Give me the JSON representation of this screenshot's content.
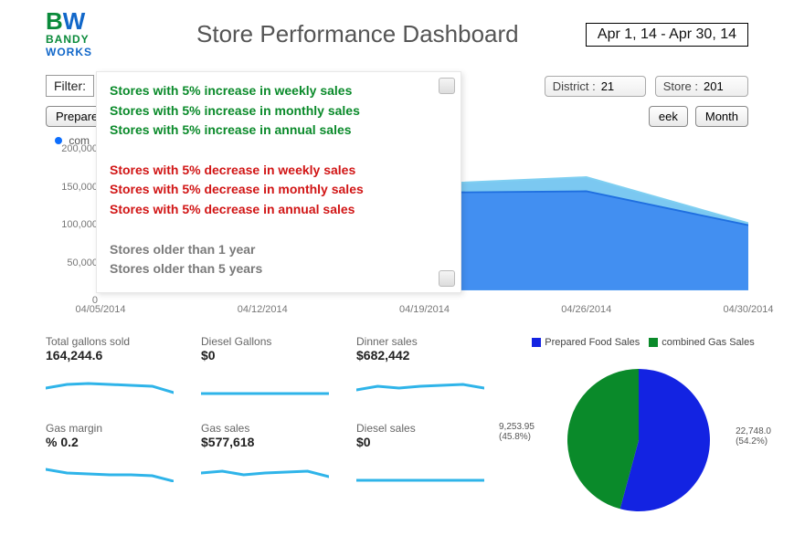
{
  "header": {
    "logo_top": "BW",
    "logo_line1": "BANDY",
    "logo_line2": "WORKS",
    "title": "Store Performance Dashboard",
    "date_range": "Apr 1, 14 - Apr 30, 14"
  },
  "controls": {
    "filter_label": "Filter:",
    "district_label": "District :",
    "district_value": "21",
    "store_label": "Store :",
    "store_value": "201"
  },
  "time_buttons": {
    "prepare_label": "Prepare",
    "week_label": "eek",
    "month_label": "Month"
  },
  "legend": {
    "combined": "combined"
  },
  "filter_dropdown": {
    "items": [
      {
        "text": "Stores with 5% increase in weekly sales",
        "cls": "fd-green"
      },
      {
        "text": "Stores with 5% increase in monthly sales",
        "cls": "fd-green"
      },
      {
        "text": "Stores with 5% increase in annual sales",
        "cls": "fd-green"
      },
      {
        "text": "",
        "cls": ""
      },
      {
        "text": "Stores with 5% decrease in weekly sales",
        "cls": "fd-red"
      },
      {
        "text": "Stores with 5% decrease in monthly sales",
        "cls": "fd-red"
      },
      {
        "text": "Stores with 5% decrease in annual sales",
        "cls": "fd-red"
      },
      {
        "text": "",
        "cls": ""
      },
      {
        "text": "Stores older than 1 year",
        "cls": "fd-gray"
      },
      {
        "text": "Stores older than 5 years",
        "cls": "fd-gray"
      }
    ]
  },
  "chart_data": {
    "type": "area",
    "xlabel": "",
    "ylabel": "",
    "ylim": [
      0,
      200000
    ],
    "y_ticks": [
      "200,000",
      "150,000",
      "100,000",
      "50,000",
      "0"
    ],
    "x_ticks": [
      "04/05/2014",
      "04/12/2014",
      "04/19/2014",
      "04/26/2014",
      "04/30/2014"
    ],
    "series": [
      {
        "name": "combined Gas Sales",
        "color": "#7fcff1",
        "fill": "#6dc2ef",
        "values": [
          90000,
          92000,
          150000,
          160000,
          95000
        ]
      },
      {
        "name": "Prepared Food Sales",
        "color": "#1f6fe0",
        "fill": "#3f8cf0",
        "values": [
          88000,
          90000,
          138000,
          140000,
          92000
        ]
      }
    ]
  },
  "metrics_top": [
    {
      "label": "Total gallons sold",
      "value": "164,244.6",
      "spark": [
        22,
        18,
        17,
        18,
        19,
        20,
        27
      ]
    },
    {
      "label": "Diesel Gallons",
      "value": "$0",
      "spark": [
        28,
        28,
        28,
        28,
        28,
        28,
        28
      ]
    },
    {
      "label": "Dinner sales",
      "value": "$682,442",
      "spark": [
        24,
        20,
        22,
        20,
        19,
        18,
        22
      ]
    }
  ],
  "metrics_bottom": [
    {
      "label": "Gas margin",
      "value": "% 0.2",
      "spark": [
        16,
        20,
        21,
        22,
        22,
        23,
        29
      ]
    },
    {
      "label": "Gas sales",
      "value": "$577,618",
      "spark": [
        20,
        18,
        22,
        20,
        19,
        18,
        24
      ]
    },
    {
      "label": "Diesel sales",
      "value": "$0",
      "spark": [
        28,
        28,
        28,
        28,
        28,
        28,
        28
      ]
    }
  ],
  "pie": {
    "legend": [
      {
        "label": "Prepared Food Sales",
        "color": "#1323e2"
      },
      {
        "label": "combined Gas Sales",
        "color": "#0a8a2a"
      }
    ],
    "slices": [
      {
        "label": "22,748.0",
        "pct": "(54.2%)",
        "value": 54.2,
        "color": "#1323e2"
      },
      {
        "label": "9,253.95",
        "pct": "(45.8%)",
        "value": 45.8,
        "color": "#0a8a2a"
      }
    ]
  }
}
